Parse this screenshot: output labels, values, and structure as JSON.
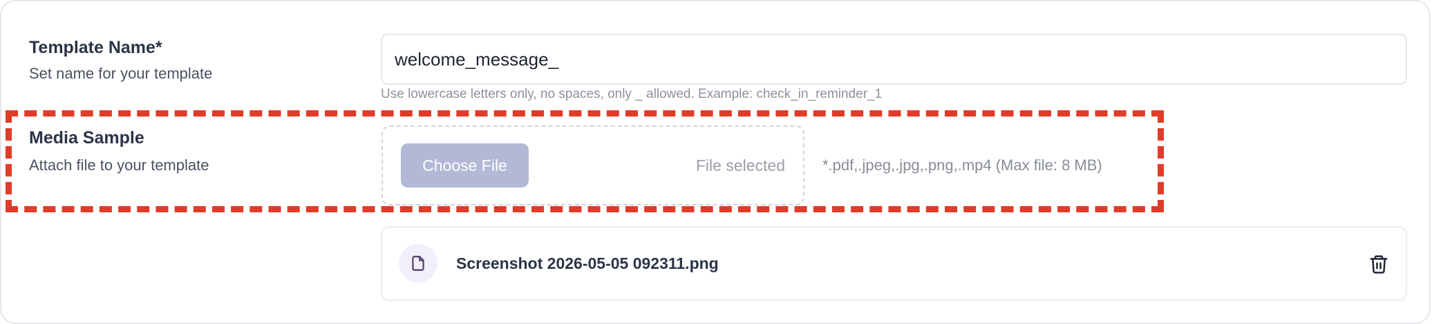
{
  "template_name": {
    "title": "Template Name*",
    "subtitle": "Set name for your template",
    "value": "welcome_message_",
    "hint": "Use lowercase letters only, no spaces, only _ allowed. Example: check_in_reminder_1"
  },
  "media_sample": {
    "title": "Media Sample",
    "subtitle": "Attach file to your template",
    "choose_label": "Choose File",
    "status": "File selected",
    "accepted": "*.pdf,.jpeg,.jpg,.png,.mp4 (Max file: 8 MB)"
  },
  "attached_file": {
    "name": "Screenshot 2026-05-05 092311.png",
    "icon": "file-icon",
    "delete_icon": "trash-icon"
  },
  "colors": {
    "highlight": "#e23b27",
    "button": "#b3b8d6",
    "icon_bg": "#f3eefb"
  }
}
